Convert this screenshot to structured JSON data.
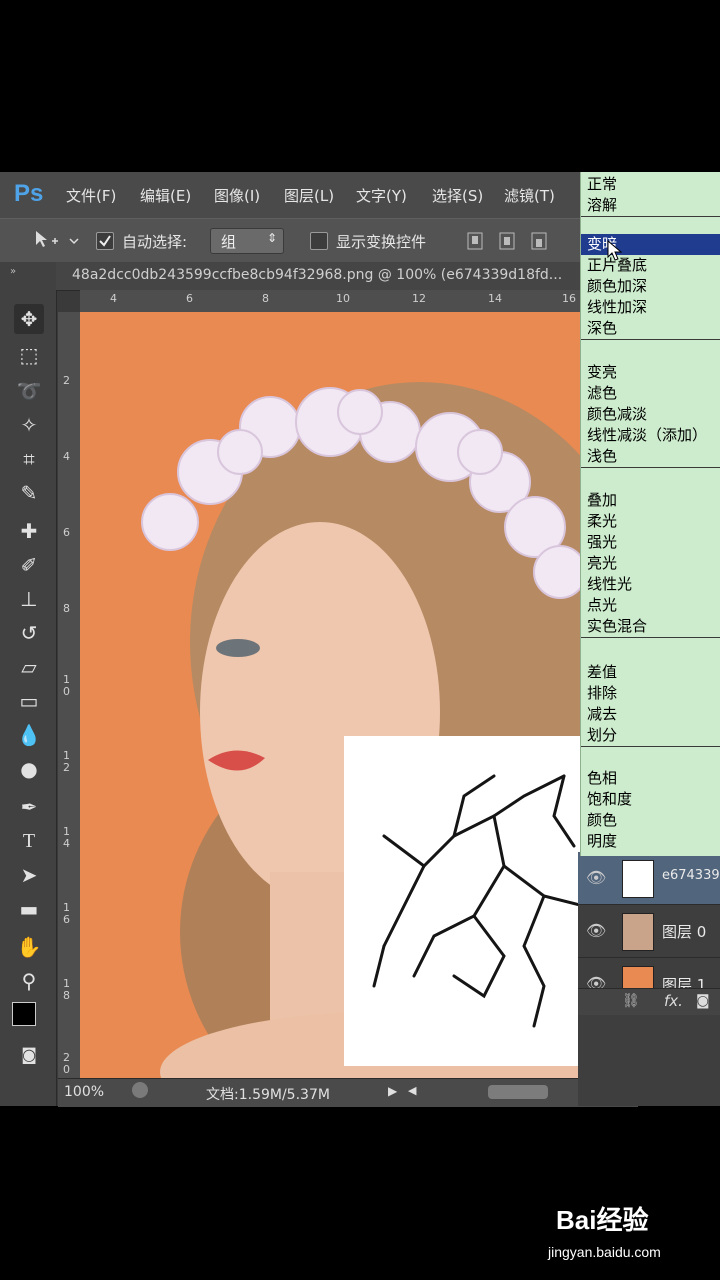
{
  "app": {
    "logo": "Ps",
    "menus": [
      "文件(F)",
      "编辑(E)",
      "图像(I)",
      "图层(L)",
      "文字(Y)",
      "选择(S)",
      "滤镜(T)"
    ]
  },
  "options_bar": {
    "auto_select_label": "自动选择:",
    "auto_select_value": "组",
    "show_transform_label": "显示变换控件"
  },
  "document": {
    "tab_title": "48a2dcc0db243599ccfbe8cb94f32968.png @ 100% (e674339d18fd...",
    "ruler_h": [
      "4",
      "6",
      "8",
      "10",
      "12",
      "14",
      "16"
    ],
    "ruler_v": [
      "2",
      "4",
      "6",
      "8",
      "1\n0",
      "1\n2",
      "1\n4",
      "1\n6",
      "1\n8",
      "2\n0"
    ]
  },
  "status": {
    "zoom": "100%",
    "doc_size": "文档:1.59M/5.37M"
  },
  "blend_modes": {
    "groups": [
      [
        "正常",
        "溶解"
      ],
      [
        "变暗",
        "正片叠底",
        "颜色加深",
        "线性加深",
        "深色"
      ],
      [
        "变亮",
        "滤色",
        "颜色减淡",
        "线性减淡（添加）",
        "浅色"
      ],
      [
        "叠加",
        "柔光",
        "强光",
        "亮光",
        "线性光",
        "点光",
        "实色混合"
      ],
      [
        "差值",
        "排除",
        "减去",
        "划分"
      ],
      [
        "色相",
        "饱和度",
        "颜色",
        "明度"
      ]
    ],
    "selected": "变暗"
  },
  "layers": {
    "items": [
      {
        "name": "e674339",
        "thumb": "#ffffff"
      },
      {
        "name": "图层 0",
        "thumb": "#c9a38a"
      },
      {
        "name": "图层 1",
        "thumb": "#e98a52"
      }
    ]
  },
  "watermark": {
    "brand": "Bai经验",
    "url": "jingyan.baidu.com"
  },
  "colors": {
    "canvas_bg": "#e98a52",
    "selection": "#1f3c8f",
    "dropdown_bg": "#cdeccd"
  }
}
